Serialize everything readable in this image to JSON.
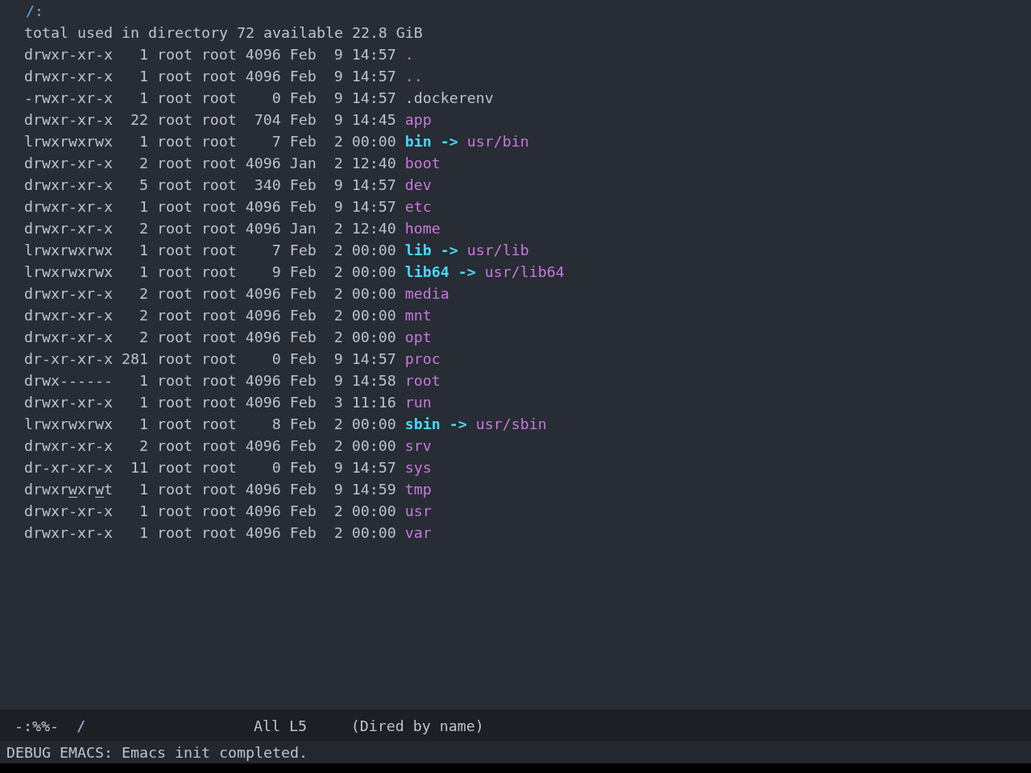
{
  "header": {
    "path": "/",
    "separator": ":"
  },
  "summary": "total used in directory 72 available 22.8 GiB",
  "entries": [
    {
      "kind": "directory",
      "permissions": [
        {
          "text": "drwxr-xr-x",
          "underlined": false
        }
      ],
      "links": "1",
      "owner": "root",
      "group": "root",
      "size": "4096",
      "month": "Feb",
      "day": "9",
      "time": "14:57",
      "name": "."
    },
    {
      "kind": "directory",
      "permissions": [
        {
          "text": "drwxr-xr-x",
          "underlined": false
        }
      ],
      "links": "1",
      "owner": "root",
      "group": "root",
      "size": "4096",
      "month": "Feb",
      "day": "9",
      "time": "14:57",
      "name": ".."
    },
    {
      "kind": "file",
      "permissions": [
        {
          "text": "-rwxr-xr-x",
          "underlined": false
        }
      ],
      "links": "1",
      "owner": "root",
      "group": "root",
      "size": "0",
      "month": "Feb",
      "day": "9",
      "time": "14:57",
      "name": ".dockerenv"
    },
    {
      "kind": "directory",
      "permissions": [
        {
          "text": "drwxr-xr-x",
          "underlined": false
        }
      ],
      "links": "22",
      "owner": "root",
      "group": "root",
      "size": "704",
      "month": "Feb",
      "day": "9",
      "time": "14:45",
      "name": "app"
    },
    {
      "kind": "symlink",
      "permissions": [
        {
          "text": "lrwxrwxrwx",
          "underlined": false
        }
      ],
      "links": "1",
      "owner": "root",
      "group": "root",
      "size": "7",
      "month": "Feb",
      "day": "2",
      "time": "00:00",
      "name": "bin",
      "arrow": "->",
      "target": "usr/bin"
    },
    {
      "kind": "directory",
      "permissions": [
        {
          "text": "drwxr-xr-x",
          "underlined": false
        }
      ],
      "links": "2",
      "owner": "root",
      "group": "root",
      "size": "4096",
      "month": "Jan",
      "day": "2",
      "time": "12:40",
      "name": "boot"
    },
    {
      "kind": "directory",
      "permissions": [
        {
          "text": "drwxr-xr-x",
          "underlined": false
        }
      ],
      "links": "5",
      "owner": "root",
      "group": "root",
      "size": "340",
      "month": "Feb",
      "day": "9",
      "time": "14:57",
      "name": "dev"
    },
    {
      "kind": "directory",
      "permissions": [
        {
          "text": "drwxr-xr-x",
          "underlined": false
        }
      ],
      "links": "1",
      "owner": "root",
      "group": "root",
      "size": "4096",
      "month": "Feb",
      "day": "9",
      "time": "14:57",
      "name": "etc"
    },
    {
      "kind": "directory",
      "permissions": [
        {
          "text": "drwxr-xr-x",
          "underlined": false
        }
      ],
      "links": "2",
      "owner": "root",
      "group": "root",
      "size": "4096",
      "month": "Jan",
      "day": "2",
      "time": "12:40",
      "name": "home"
    },
    {
      "kind": "symlink",
      "permissions": [
        {
          "text": "lrwxrwxrwx",
          "underlined": false
        }
      ],
      "links": "1",
      "owner": "root",
      "group": "root",
      "size": "7",
      "month": "Feb",
      "day": "2",
      "time": "00:00",
      "name": "lib",
      "arrow": "->",
      "target": "usr/lib"
    },
    {
      "kind": "symlink",
      "permissions": [
        {
          "text": "lrwxrwxrwx",
          "underlined": false
        }
      ],
      "links": "1",
      "owner": "root",
      "group": "root",
      "size": "9",
      "month": "Feb",
      "day": "2",
      "time": "00:00",
      "name": "lib64",
      "arrow": "->",
      "target": "usr/lib64"
    },
    {
      "kind": "directory",
      "permissions": [
        {
          "text": "drwxr-xr-x",
          "underlined": false
        }
      ],
      "links": "2",
      "owner": "root",
      "group": "root",
      "size": "4096",
      "month": "Feb",
      "day": "2",
      "time": "00:00",
      "name": "media"
    },
    {
      "kind": "directory",
      "permissions": [
        {
          "text": "drwxr-xr-x",
          "underlined": false
        }
      ],
      "links": "2",
      "owner": "root",
      "group": "root",
      "size": "4096",
      "month": "Feb",
      "day": "2",
      "time": "00:00",
      "name": "mnt"
    },
    {
      "kind": "directory",
      "permissions": [
        {
          "text": "drwxr-xr-x",
          "underlined": false
        }
      ],
      "links": "2",
      "owner": "root",
      "group": "root",
      "size": "4096",
      "month": "Feb",
      "day": "2",
      "time": "00:00",
      "name": "opt"
    },
    {
      "kind": "directory",
      "permissions": [
        {
          "text": "dr-xr-xr-x",
          "underlined": false
        }
      ],
      "links": "281",
      "owner": "root",
      "group": "root",
      "size": "0",
      "month": "Feb",
      "day": "9",
      "time": "14:57",
      "name": "proc"
    },
    {
      "kind": "directory",
      "permissions": [
        {
          "text": "drwx------",
          "underlined": false
        }
      ],
      "links": "1",
      "owner": "root",
      "group": "root",
      "size": "4096",
      "month": "Feb",
      "day": "9",
      "time": "14:58",
      "name": "root"
    },
    {
      "kind": "directory",
      "permissions": [
        {
          "text": "drwxr-xr-x",
          "underlined": false
        }
      ],
      "links": "1",
      "owner": "root",
      "group": "root",
      "size": "4096",
      "month": "Feb",
      "day": "3",
      "time": "11:16",
      "name": "run"
    },
    {
      "kind": "symlink",
      "permissions": [
        {
          "text": "lrwxrwxrwx",
          "underlined": false
        }
      ],
      "links": "1",
      "owner": "root",
      "group": "root",
      "size": "8",
      "month": "Feb",
      "day": "2",
      "time": "00:00",
      "name": "sbin",
      "arrow": "->",
      "target": "usr/sbin"
    },
    {
      "kind": "directory",
      "permissions": [
        {
          "text": "drwxr-xr-x",
          "underlined": false
        }
      ],
      "links": "2",
      "owner": "root",
      "group": "root",
      "size": "4096",
      "month": "Feb",
      "day": "2",
      "time": "00:00",
      "name": "srv"
    },
    {
      "kind": "directory",
      "permissions": [
        {
          "text": "dr-xr-xr-x",
          "underlined": false
        }
      ],
      "links": "11",
      "owner": "root",
      "group": "root",
      "size": "0",
      "month": "Feb",
      "day": "9",
      "time": "14:57",
      "name": "sys"
    },
    {
      "kind": "directory",
      "permissions": [
        {
          "text": "drwxr",
          "underlined": false
        },
        {
          "text": "w",
          "underlined": true
        },
        {
          "text": "xr",
          "underlined": false
        },
        {
          "text": "w",
          "underlined": true
        },
        {
          "text": "t",
          "underlined": false
        }
      ],
      "links": "1",
      "owner": "root",
      "group": "root",
      "size": "4096",
      "month": "Feb",
      "day": "9",
      "time": "14:59",
      "name": "tmp"
    },
    {
      "kind": "directory",
      "permissions": [
        {
          "text": "drwxr-xr-x",
          "underlined": false
        }
      ],
      "links": "1",
      "owner": "root",
      "group": "root",
      "size": "4096",
      "month": "Feb",
      "day": "2",
      "time": "00:00",
      "name": "usr"
    },
    {
      "kind": "directory",
      "permissions": [
        {
          "text": "drwxr-xr-x",
          "underlined": false
        }
      ],
      "links": "1",
      "owner": "root",
      "group": "root",
      "size": "4096",
      "month": "Feb",
      "day": "2",
      "time": "00:00",
      "name": "var"
    }
  ],
  "mode_line": {
    "status": "-:%%-",
    "buffer": "/",
    "position": "All L5",
    "mode": "(Dired by name)"
  },
  "echo_area": "DEBUG EMACS: Emacs init completed."
}
